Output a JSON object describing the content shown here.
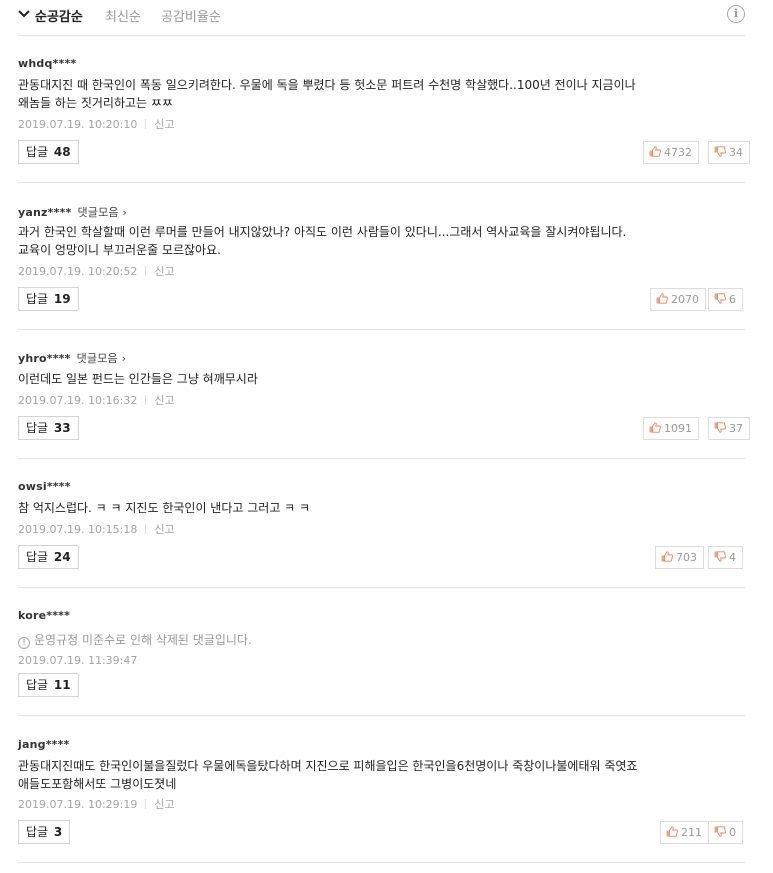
{
  "sort": {
    "options": [
      "순공감순",
      "최신순",
      "공감비율순"
    ],
    "info_label": "i"
  },
  "labels": {
    "reply": "답글",
    "report": "신고",
    "collect": "댓글모음 ›"
  },
  "comments": [
    {
      "author": "whdq****",
      "text": "관동대지진 때 한국인이 폭동 일으키려한다. 우물에 독을 뿌렸다 등 헛소문 퍼트려 수천명 학살했다..100년 전이나 지금이나\n왜놈들 하는 짓거리하고는 ㅉㅉ",
      "date": "2019.07.19. 10:20:10",
      "replies": "48",
      "likes": "4732",
      "dislikes": "34"
    },
    {
      "author": "yanz****",
      "text": "과거 한국인 학살할때 이런 루머를 만들어 내지않았나? 아직도 이런 사람들이 있다니...그래서 역사교육을 잘시켜야됩니다.\n교육이 엉망이니 부끄러운줄 모르잖아요.",
      "date": "2019.07.19. 10:20:52",
      "replies": "19",
      "likes": "2070",
      "dislikes": "6"
    },
    {
      "author": "yhro****",
      "text": "이런데도 일본 펀드는 인간들은 그냥 혀깨무시라",
      "date": "2019.07.19. 10:16:32",
      "replies": "33",
      "likes": "1091",
      "dislikes": "37"
    },
    {
      "author": "owsi****",
      "text": "참 억지스럽다. ㅋ ㅋ 지진도 한국인이 낸다고 그러고 ㅋ ㅋ",
      "date": "2019.07.19. 10:15:18",
      "replies": "24",
      "likes": "703",
      "dislikes": "4"
    },
    {
      "author": "kore****",
      "text": "운영규정 미준수로 인해 삭제된 댓글입니다.",
      "date": "2019.07.19. 11:39:47",
      "replies": "11"
    },
    {
      "author": "jang****",
      "text": "관동대지진때도 한국인이불을질렀다 우물에독을탔다하며 지진으로 피해을입은 한국인을6천명이나 죽창이나불에태워 죽엿죠\n애들도포함해서또 그병이도졋네",
      "date": "2019.07.19. 10:29:19",
      "replies": "3",
      "likes": "211",
      "dislikes": "0"
    }
  ]
}
